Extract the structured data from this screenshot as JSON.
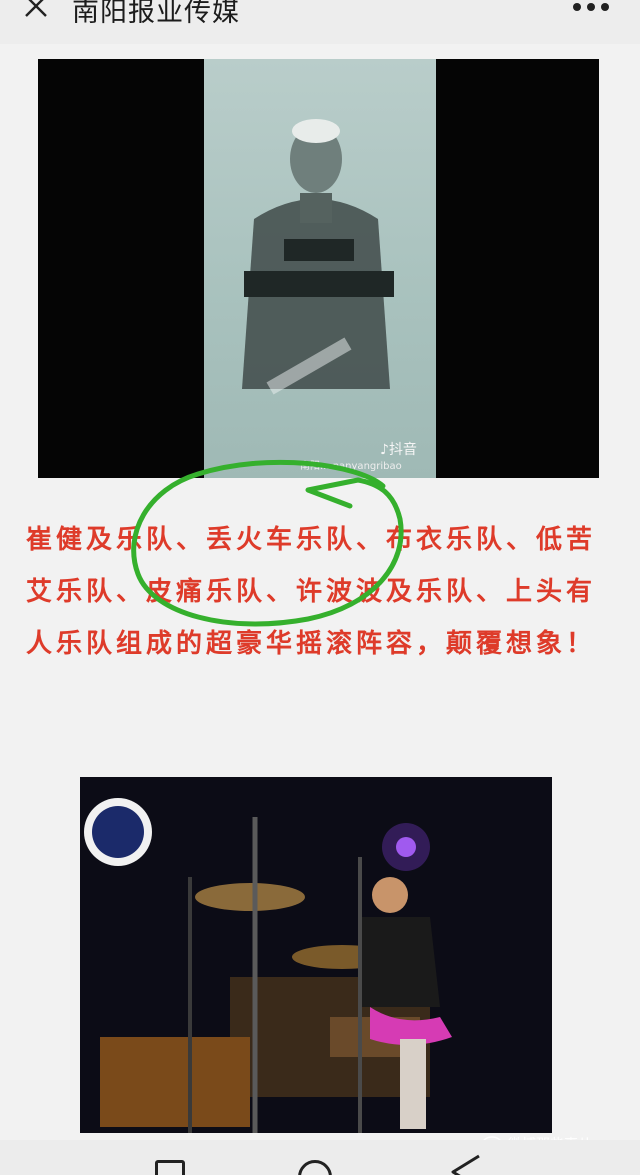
{
  "header": {
    "title": "南阳报业传媒",
    "close_icon": "close-icon",
    "more_icon": "more-dots-icon"
  },
  "video": {
    "tiktok_label": "抖音",
    "tiktok_id": "南阳... nanyangribao"
  },
  "article": {
    "paragraph": "崔健及乐队、丢火车乐队、布衣乐队、低苦艾乐队、皮痛乐队、许波波及乐队、上头有人乐队组成的超豪华摇滚阵容，颠覆想象！",
    "accent_color": "#de3b2a",
    "annotation_color": "#35b02d"
  },
  "watermark": {
    "text": "微博那些事儿"
  },
  "nav": {
    "icons": [
      "recent-apps-icon",
      "home-icon",
      "back-icon"
    ]
  }
}
